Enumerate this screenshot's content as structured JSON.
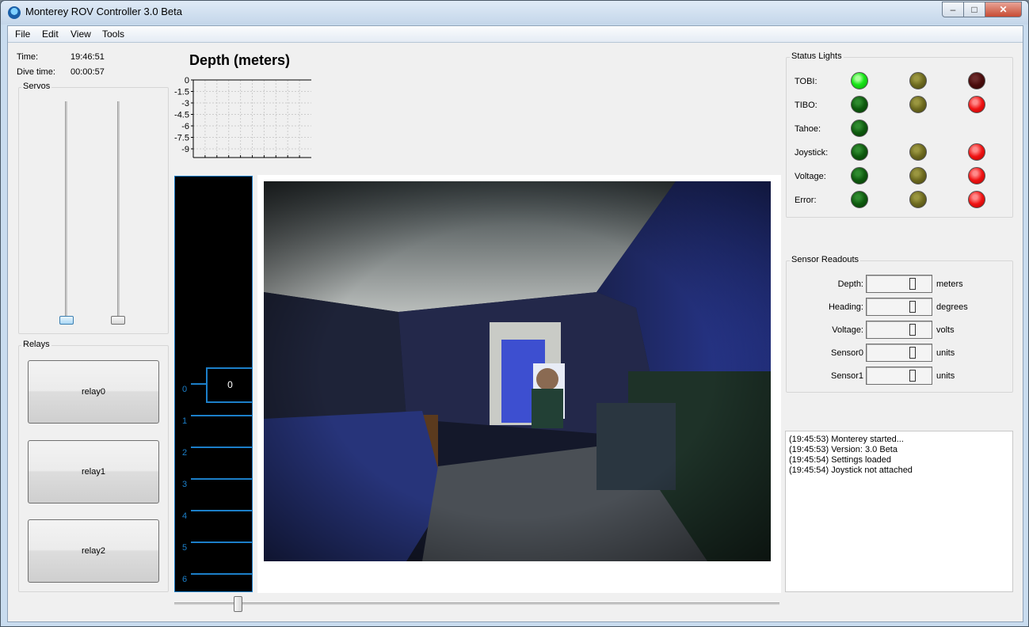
{
  "window": {
    "title": "Monterey ROV Controller 3.0 Beta",
    "min_glyph": "–",
    "max_glyph": "□",
    "close_glyph": "✕"
  },
  "menu": [
    "File",
    "Edit",
    "View",
    "Tools"
  ],
  "info": {
    "time_label": "Time:",
    "time_value": "19:46:51",
    "dive_label": "Dive time:",
    "dive_value": "00:00:57"
  },
  "servos": {
    "title": "Servos",
    "values": [
      0,
      0
    ]
  },
  "relays": {
    "title": "Relays",
    "buttons": [
      "relay0",
      "relay1",
      "relay2"
    ]
  },
  "depth_plot": {
    "title": "Depth (meters)",
    "y_ticks": [
      "0",
      "-1.5",
      "-3",
      "-4.5",
      "-6",
      "-7.5",
      "-9"
    ]
  },
  "gauge": {
    "value": "0",
    "ticks": [
      "0",
      "1",
      "2",
      "3",
      "4",
      "5",
      "6"
    ]
  },
  "status_lights": {
    "title": "Status Lights",
    "rows": [
      {
        "label": "TOBI:",
        "lights": [
          "green-bright",
          "yellow-dark",
          "red-dark"
        ]
      },
      {
        "label": "TIBO:",
        "lights": [
          "green-dark",
          "yellow-dark",
          "red-bright"
        ]
      },
      {
        "label": "Tahoe:",
        "lights": [
          "green-dark"
        ]
      },
      {
        "label": "Joystick:",
        "lights": [
          "green-dark",
          "yellow-dark",
          "red-bright"
        ]
      },
      {
        "label": "Voltage:",
        "lights": [
          "green-dark",
          "yellow-dark",
          "red-bright"
        ]
      },
      {
        "label": "Error:",
        "lights": [
          "green-dark",
          "yellow-dark",
          "red-bright"
        ]
      }
    ]
  },
  "sensors": {
    "title": "Sensor Readouts",
    "rows": [
      {
        "label": "Depth:",
        "unit": "meters"
      },
      {
        "label": "Heading:",
        "unit": "degrees"
      },
      {
        "label": "Voltage:",
        "unit": "volts"
      },
      {
        "label": "Sensor0",
        "unit": "units"
      },
      {
        "label": "Sensor1",
        "unit": "units"
      }
    ]
  },
  "log": [
    "(19:45:53) Monterey started...",
    "(19:45:53) Version: 3.0 Beta",
    "(19:45:54) Settings loaded",
    "(19:45:54) Joystick not attached"
  ],
  "colors": {
    "accent": "#1c7fc9",
    "gauge_bg": "#000000",
    "window_frame": "#c9dcef"
  },
  "timeline": {
    "position": 0.1
  }
}
